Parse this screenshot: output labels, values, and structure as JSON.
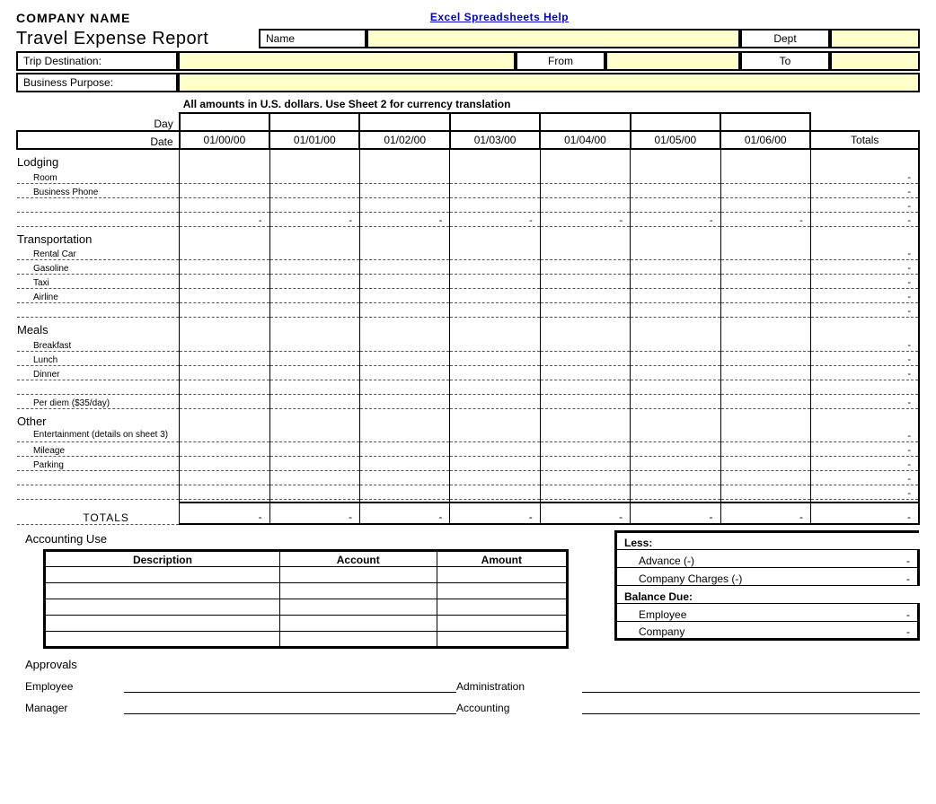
{
  "header": {
    "company": "COMPANY NAME",
    "help_link": "Excel Spreadsheets Help",
    "title": "Travel Expense Report",
    "name_label": "Name",
    "name_value": "",
    "dept_label": "Dept",
    "dept_value": "",
    "trip_label": "Trip Destination:",
    "trip_value": "",
    "from_label": "From",
    "from_value": "",
    "to_label": "To",
    "to_value": "",
    "purpose_label": "Business Purpose:",
    "purpose_value": "",
    "currency_note": "All amounts in U.S. dollars.  Use Sheet 2 for currency translation"
  },
  "grid": {
    "day_label": "Day",
    "date_label": "Date",
    "dates": [
      "01/00/00",
      "01/01/00",
      "01/02/00",
      "01/03/00",
      "01/04/00",
      "01/05/00",
      "01/06/00"
    ],
    "totals_label": "Totals",
    "sections": [
      {
        "title": "Lodging",
        "items": [
          {
            "label": "Room",
            "total": "-"
          },
          {
            "label": "Business Phone",
            "total": "-"
          },
          {
            "label": "",
            "total": "-"
          },
          {
            "label": "",
            "vals": [
              "-",
              "-",
              "-",
              "-",
              "-",
              "-",
              "-"
            ],
            "total": "-"
          }
        ]
      },
      {
        "title": "Transportation",
        "items": [
          {
            "label": "Rental Car",
            "total": "-"
          },
          {
            "label": "Gasoline",
            "total": "-"
          },
          {
            "label": "Taxi",
            "total": "-"
          },
          {
            "label": "Airline",
            "total": "-"
          },
          {
            "label": "",
            "total": "-"
          }
        ]
      },
      {
        "title": "Meals",
        "items": [
          {
            "label": "Breakfast",
            "total": "-"
          },
          {
            "label": "Lunch",
            "total": "-"
          },
          {
            "label": "Dinner",
            "total": "-"
          },
          {
            "label": "",
            "total": ""
          },
          {
            "label": "Per diem ($35/day)",
            "total": "-"
          }
        ]
      },
      {
        "title": "Other",
        "items": [
          {
            "label": "Entertainment (details on sheet 3)",
            "wrap": true,
            "total": "-"
          },
          {
            "label": "Mileage",
            "total": "-"
          },
          {
            "label": "Parking",
            "total": "-"
          },
          {
            "label": "",
            "total": "-"
          },
          {
            "label": "",
            "total": "-"
          }
        ]
      }
    ],
    "totals_row": {
      "label": "TOTALS",
      "vals": [
        "-",
        "-",
        "-",
        "-",
        "-",
        "-",
        "-"
      ],
      "total": "-"
    }
  },
  "accounting": {
    "title": "Accounting Use",
    "headers": [
      "Description",
      "Account",
      "Amount"
    ],
    "rows": 5
  },
  "balance": {
    "less": "Less:",
    "advance": "Advance (-)",
    "advance_val": "-",
    "company_charges": "Company Charges (-)",
    "company_charges_val": "-",
    "balance_due": "Balance Due:",
    "employee": "Employee",
    "employee_val": "-",
    "company": "Company",
    "company_val": "-"
  },
  "approvals": {
    "title": "Approvals",
    "employee": "Employee",
    "manager": "Manager",
    "administration": "Administration",
    "accounting": "Accounting"
  }
}
